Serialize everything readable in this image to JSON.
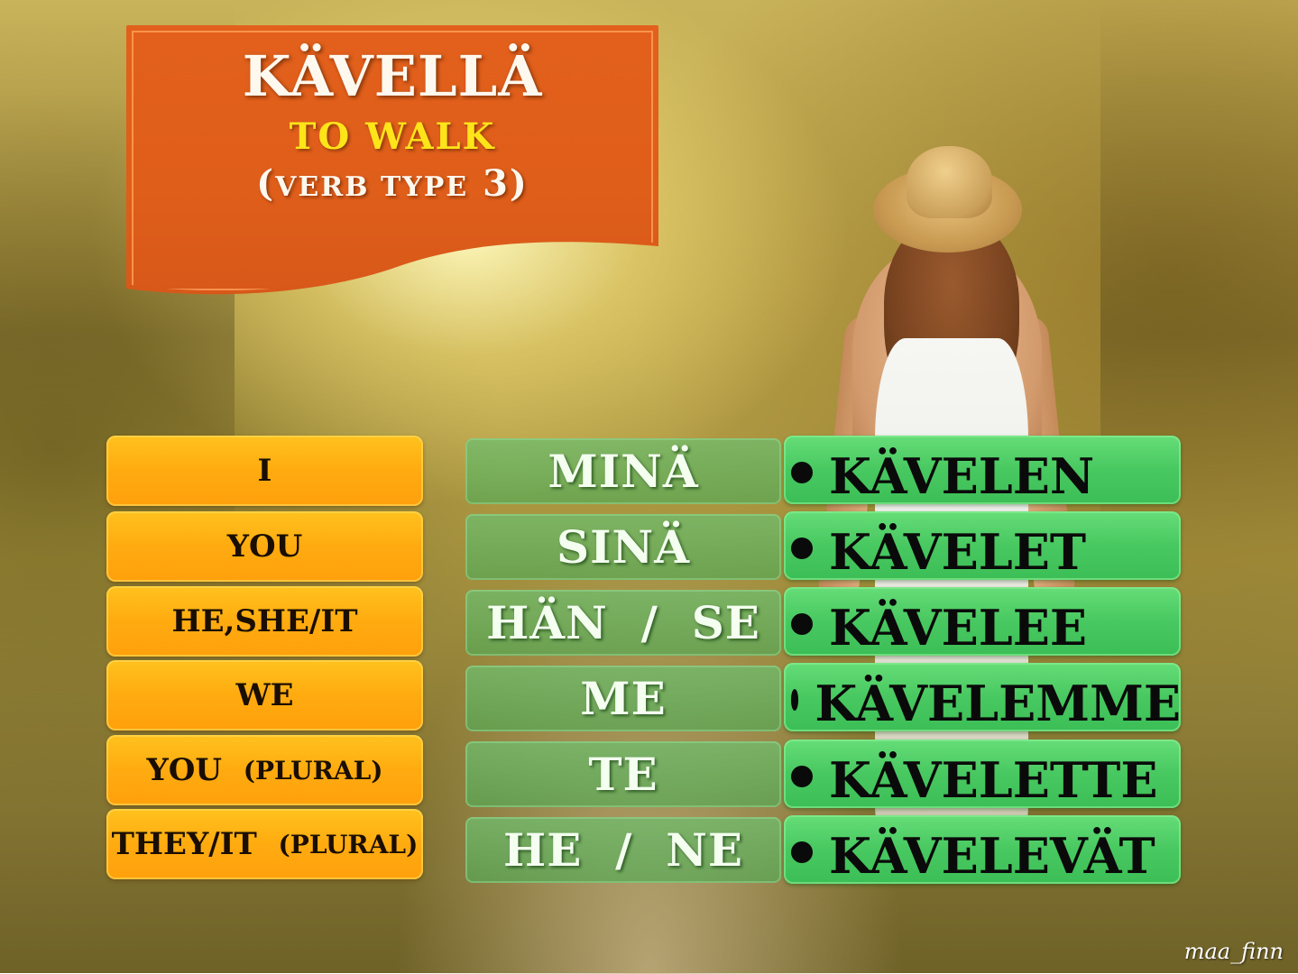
{
  "title": {
    "verb": "KÄVELLÄ",
    "translation": "TO  WALK",
    "verb_type_open": "(",
    "verb_type_label": "VERB  TYPE",
    "verb_type_number": " 3",
    "verb_type_close": ")"
  },
  "rows": [
    {
      "english": "I",
      "english_extra": "",
      "pronoun": "MINÄ",
      "conjugation": "KÄVELEN"
    },
    {
      "english": "YOU",
      "english_extra": "",
      "pronoun": "SINÄ",
      "conjugation": "KÄVELET"
    },
    {
      "english": "HE,SHE/IT",
      "english_extra": "",
      "pronoun": "HÄN  /  SE",
      "conjugation": "KÄVELEE"
    },
    {
      "english": "WE",
      "english_extra": "",
      "pronoun": "ME",
      "conjugation": "KÄVELEMME"
    },
    {
      "english": "YOU  ",
      "english_extra": "(PLURAL)",
      "pronoun": "TE",
      "conjugation": "KÄVELETTE"
    },
    {
      "english": "THEY/IT  ",
      "english_extra": "(PLURAL)",
      "pronoun": "HE  /  NE",
      "conjugation": "KÄVELEVÄT"
    }
  ],
  "watermark": "maa_finn",
  "colors": {
    "banner": "#e2601c",
    "title_text": "#fff8ee",
    "translation_text": "#ffe41a",
    "english_cell": "#ffab10",
    "pronoun_cell": "#5fb569",
    "conjugation_cell": "#48c860"
  }
}
